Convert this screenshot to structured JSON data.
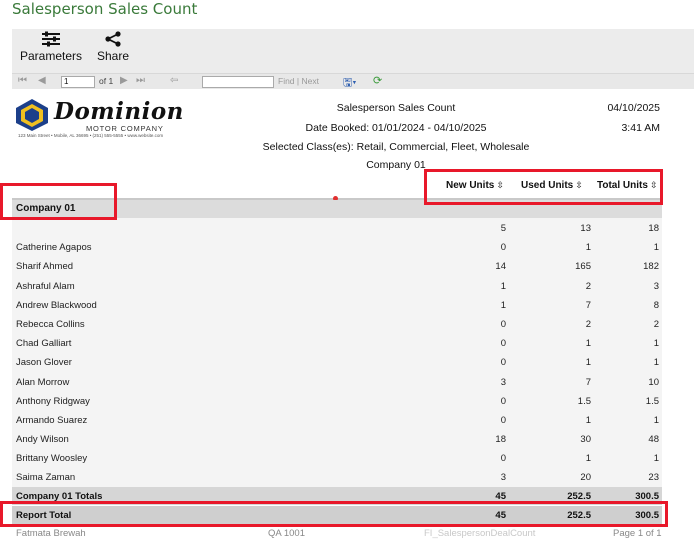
{
  "page": {
    "title": "Salesperson Sales Count"
  },
  "toolbar": {
    "parameters_label": "Parameters",
    "share_label": "Share",
    "page_value": "1",
    "page_of": "of 1",
    "find_label": "Find | Next"
  },
  "report_header": {
    "logo": {
      "name": "Dominion",
      "subtitle": "MOTOR COMPANY",
      "address": "123 Main Street • Mobile, AL 36695 • (251) 555-5555 • www.website.com"
    },
    "title": "Salesperson Sales Count",
    "date_line": "Date Booked: 01/01/2024 -  04/10/2025",
    "classes_line": "Selected Class(es): Retail, Commercial, Fleet, Wholesale",
    "company_line": "Company 01",
    "date": "04/10/2025",
    "time": "3:41 AM"
  },
  "columns": {
    "new": "New Units",
    "used": "Used Units",
    "total": "Total Units"
  },
  "group": {
    "label": "Company 01"
  },
  "rows": [
    {
      "name": "",
      "new": "5",
      "used": "13",
      "total": "18"
    },
    {
      "name": "Catherine Agapos",
      "new": "0",
      "used": "1",
      "total": "1"
    },
    {
      "name": "Sharif Ahmed",
      "new": "14",
      "used": "165",
      "total": "182"
    },
    {
      "name": "Ashraful Alam",
      "new": "1",
      "used": "2",
      "total": "3"
    },
    {
      "name": "Andrew Blackwood",
      "new": "1",
      "used": "7",
      "total": "8"
    },
    {
      "name": "Rebecca Collins",
      "new": "0",
      "used": "2",
      "total": "2"
    },
    {
      "name": "Chad Galliart",
      "new": "0",
      "used": "1",
      "total": "1"
    },
    {
      "name": "Jason Glover",
      "new": "0",
      "used": "1",
      "total": "1"
    },
    {
      "name": "Alan Morrow",
      "new": "3",
      "used": "7",
      "total": "10"
    },
    {
      "name": "Anthony Ridgway",
      "new": "0",
      "used": "1.5",
      "total": "1.5"
    },
    {
      "name": "Armando Suarez",
      "new": "0",
      "used": "1",
      "total": "1"
    },
    {
      "name": "Andy Wilson",
      "new": "18",
      "used": "30",
      "total": "48"
    },
    {
      "name": "Brittany Woosley",
      "new": "0",
      "used": "1",
      "total": "1"
    },
    {
      "name": "Saima Zaman",
      "new": "3",
      "used": "20",
      "total": "23"
    }
  ],
  "company_totals": {
    "label": "Company 01 Totals",
    "new": "45",
    "used": "252.5",
    "total": "300.5"
  },
  "report_total": {
    "label": "Report Total",
    "new": "45",
    "used": "252.5",
    "total": "300.5"
  },
  "footer": {
    "user": "Fatmata Brewah",
    "env": "QA 1001",
    "report_name": "FI_SalespersonDealCount",
    "page": "Page 1 of 1"
  },
  "colors": {
    "title_green": "#3a7a3a",
    "highlight_red": "#e8182a"
  }
}
